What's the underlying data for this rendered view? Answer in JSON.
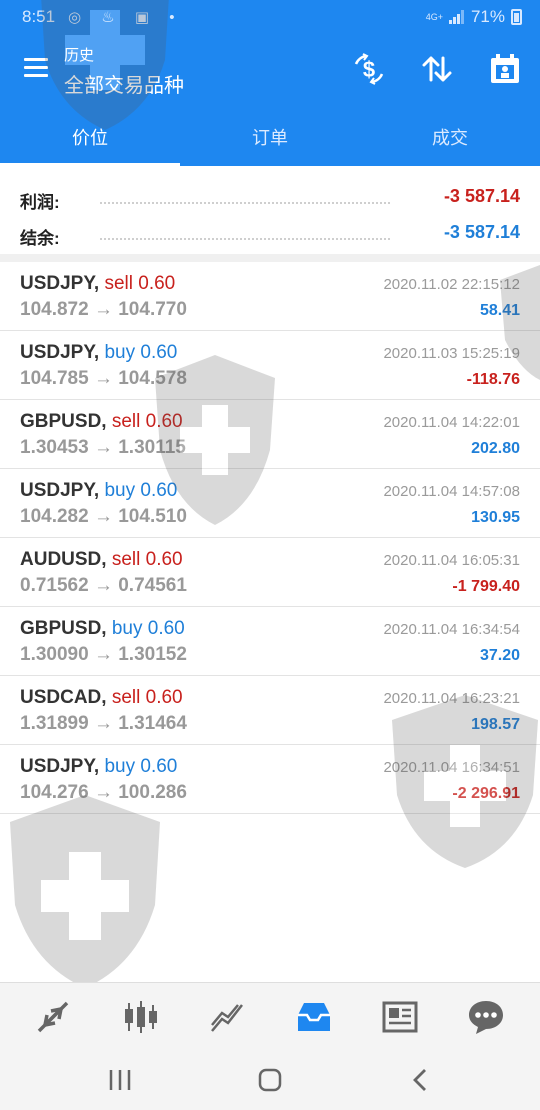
{
  "status_bar": {
    "time": "8:51",
    "network": "4G+",
    "battery": "71%"
  },
  "header": {
    "subtitle": "历史",
    "title": "全部交易品种",
    "icons": [
      "currency-exchange-icon",
      "sort-icon",
      "calendar-icon"
    ]
  },
  "tabs": [
    {
      "label": "价位",
      "active": true
    },
    {
      "label": "订单",
      "active": false
    },
    {
      "label": "成交",
      "active": false
    }
  ],
  "summary": {
    "profit_label": "利润:",
    "profit_value": "-3 587.14",
    "balance_label": "结余:",
    "balance_value": "-3 587.14"
  },
  "deals": [
    {
      "symbol": "USDJPY,",
      "side": "sell 0.60",
      "prices": "104.872 → 104.770",
      "time": "2020.11.02 22:15:12",
      "profit": "58.41"
    },
    {
      "symbol": "USDJPY,",
      "side": "buy 0.60",
      "prices": "104.785 → 104.578",
      "time": "2020.11.03 15:25:19",
      "profit": "-118.76"
    },
    {
      "symbol": "GBPUSD,",
      "side": "sell 0.60",
      "prices": "1.30453 → 1.30115",
      "time": "2020.11.04 14:22:01",
      "profit": "202.80"
    },
    {
      "symbol": "USDJPY,",
      "side": "buy 0.60",
      "prices": "104.282 → 104.510",
      "time": "2020.11.04 14:57:08",
      "profit": "130.95"
    },
    {
      "symbol": "AUDUSD,",
      "side": "sell 0.60",
      "prices": "0.71562 → 0.74561",
      "time": "2020.11.04 16:05:31",
      "profit": "-1 799.40"
    },
    {
      "symbol": "GBPUSD,",
      "side": "buy 0.60",
      "prices": "1.30090 → 1.30152",
      "time": "2020.11.04 16:34:54",
      "profit": "37.20"
    },
    {
      "symbol": "USDCAD,",
      "side": "sell 0.60",
      "prices": "1.31899 → 1.31464",
      "time": "2020.11.04 16:23:21",
      "profit": "198.57"
    },
    {
      "symbol": "USDJPY,",
      "side": "buy 0.60",
      "prices": "104.276 → 100.286",
      "time": "2020.11.04 16:34:51",
      "profit": "-2 296.91"
    }
  ],
  "bottom_nav": [
    "quotes-icon",
    "chart-icon",
    "trade-icon",
    "history-icon",
    "news-icon",
    "chat-icon"
  ],
  "active_nav": "history-icon",
  "colors": {
    "header": "#1e87f0",
    "negative": "#c8211d",
    "positive": "#1f7fd8"
  }
}
